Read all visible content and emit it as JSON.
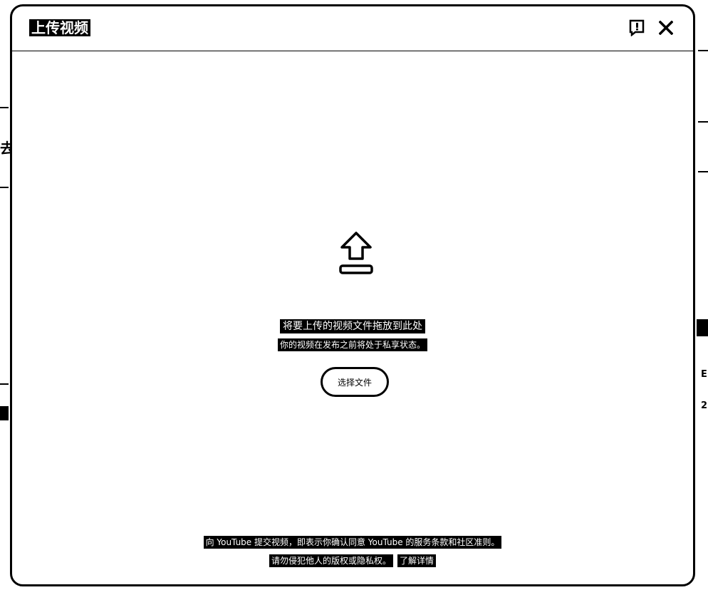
{
  "dialog": {
    "title": "上传视频",
    "feedback_icon": "feedback-flag-icon",
    "close_icon": "close-icon"
  },
  "upload": {
    "icon": "upload-arrow-icon",
    "title": "将要上传的视频文件拖放到此处",
    "subtitle": "你的视频在发布之前将处于私享状态。",
    "select_button_label": "选择文件"
  },
  "footer": {
    "terms_line": "向 YouTube 提交视频，即表示你确认同意 YouTube 的服务条款和社区准则。",
    "rights_line": "请勿侵犯他人的版权或隐私权。",
    "learn_more_label": "了解详情"
  },
  "background": {
    "left_char": "去",
    "right_char_1": "E",
    "right_char_2": "2"
  }
}
